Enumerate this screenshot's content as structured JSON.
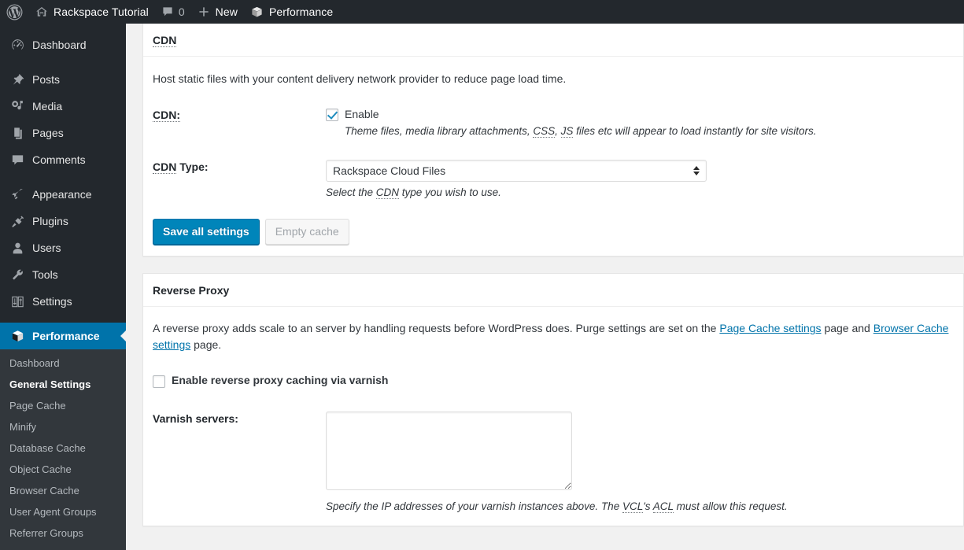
{
  "adminbar": {
    "wp_logo_icon": "wordpress-logo-icon",
    "site_icon": "home-icon",
    "site_name": "Rackspace Tutorial",
    "comments_icon": "comment-bubble-icon",
    "comments_count": "0",
    "new_icon": "plus-icon",
    "new_label": "New",
    "performance_icon": "w3tc-cube-icon",
    "performance_label": "Performance"
  },
  "sidebar": {
    "items": [
      {
        "label": "Dashboard",
        "icon": "dashboard-gauge-icon",
        "current": false,
        "sep_after": true
      },
      {
        "label": "Posts",
        "icon": "pushpin-icon",
        "current": false,
        "sep_after": false
      },
      {
        "label": "Media",
        "icon": "media-music-icon",
        "current": false,
        "sep_after": false
      },
      {
        "label": "Pages",
        "icon": "pages-icon",
        "current": false,
        "sep_after": false
      },
      {
        "label": "Comments",
        "icon": "comment-bubble-icon",
        "current": false,
        "sep_after": true
      },
      {
        "label": "Appearance",
        "icon": "paintbrush-icon",
        "current": false,
        "sep_after": false
      },
      {
        "label": "Plugins",
        "icon": "plug-icon",
        "current": false,
        "sep_after": false
      },
      {
        "label": "Users",
        "icon": "user-icon",
        "current": false,
        "sep_after": false
      },
      {
        "label": "Tools",
        "icon": "wrench-icon",
        "current": false,
        "sep_after": false
      },
      {
        "label": "Settings",
        "icon": "sliders-icon",
        "current": false,
        "sep_after": true
      },
      {
        "label": "Performance",
        "icon": "w3tc-cube-icon",
        "current": true,
        "sep_after": false
      }
    ],
    "submenu": [
      {
        "label": "Dashboard",
        "current": false
      },
      {
        "label": "General Settings",
        "current": true
      },
      {
        "label": "Page Cache",
        "current": false
      },
      {
        "label": "Minify",
        "current": false
      },
      {
        "label": "Database Cache",
        "current": false
      },
      {
        "label": "Object Cache",
        "current": false
      },
      {
        "label": "Browser Cache",
        "current": false
      },
      {
        "label": "User Agent Groups",
        "current": false
      },
      {
        "label": "Referrer Groups",
        "current": false
      }
    ]
  },
  "cdn_box": {
    "title": "CDN",
    "title_is_abbr": true,
    "description": "Host static files with your content delivery network provider to reduce page load time.",
    "enable_row": {
      "label": "CDN:",
      "checkbox_label": "Enable",
      "checked": true,
      "hint_pre": "Theme files, media library attachments, ",
      "hint_abbr1": "CSS",
      "hint_mid": ", ",
      "hint_abbr2": "JS",
      "hint_post": " files etc will appear to load instantly for site visitors."
    },
    "type_row": {
      "label_abbr": "CDN",
      "label_rest": " Type:",
      "selected": "Rackspace Cloud Files",
      "options": [
        "Rackspace Cloud Files"
      ],
      "hint_pre": "Select the ",
      "hint_abbr": "CDN",
      "hint_post": " type you wish to use."
    },
    "save_label": "Save all settings",
    "empty_cache_label": "Empty cache",
    "empty_cache_disabled": true
  },
  "reverse_proxy_box": {
    "title": "Reverse Proxy",
    "desc_pre": "A reverse proxy adds scale to an server by handling requests before WordPress does. Purge settings are set on the ",
    "desc_link1": "Page Cache settings",
    "desc_mid": " page and ",
    "desc_link2": "Browser Cache settings",
    "desc_post": " page.",
    "enable_checkbox_label": "Enable reverse proxy caching via varnish",
    "enable_checked": false,
    "varnish_label": "Varnish servers:",
    "varnish_value": "",
    "varnish_hint_pre": "Specify the IP addresses of your varnish instances above. The ",
    "varnish_hint_abbr1": "VCL",
    "varnish_hint_mid": "'s ",
    "varnish_hint_abbr2": "ACL",
    "varnish_hint_post": " must allow this request."
  },
  "colors": {
    "adminbar_bg": "#23282d",
    "sidebar_bg": "#23282d",
    "submenu_bg": "#32373c",
    "accent_blue": "#0073aa",
    "button_blue": "#0085ba",
    "page_bg": "#f1f1f1",
    "link_blue": "#0073aa"
  }
}
